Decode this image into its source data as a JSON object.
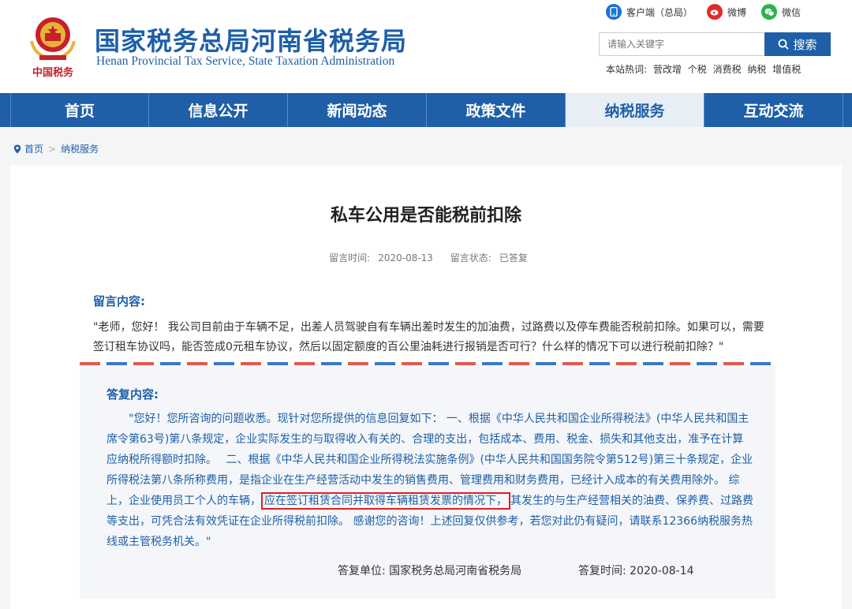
{
  "header": {
    "title_cn": "国家税务总局河南省税务局",
    "title_en": "Henan Provincial Tax Service, State Taxation Administration",
    "seal_text": "中国税务",
    "social": {
      "client": "客户端（总局）",
      "weibo": "微博",
      "wechat": "微信"
    },
    "search": {
      "placeholder": "请输入关键字",
      "button": "搜索"
    },
    "hotwords": {
      "label": "本站热词:",
      "items": [
        "营改增",
        "个税",
        "消费税",
        "纳税",
        "增值税"
      ]
    }
  },
  "nav": {
    "items": [
      {
        "label": "首页"
      },
      {
        "label": "信息公开"
      },
      {
        "label": "新闻动态"
      },
      {
        "label": "政策文件"
      },
      {
        "label": "纳税服务"
      },
      {
        "label": "互动交流"
      }
    ],
    "active_index": 4
  },
  "breadcrumb": {
    "home": "首页",
    "sep": ">",
    "current": "纳税服务"
  },
  "article": {
    "title": "私车公用是否能税前扣除",
    "meta": {
      "time_label": "留言时间:",
      "time": "2020-08-13",
      "status_label": "留言状态:",
      "status": "已答复"
    },
    "question": {
      "heading": "留言内容:",
      "text": "\"老师，您好！ 我公司目前由于车辆不足，出差人员驾驶自有车辆出差时发生的加油费，过路费以及停车费能否税前扣除。如果可以，需要签订租车协议吗，能否签成0元租车协议，然后以固定额度的百公里油耗进行报销是否可行？什么样的情况下可以进行税前扣除？\""
    },
    "answer": {
      "heading": "答复内容:",
      "text_before": "\"您好！您所咨询的问题收悉。现针对您所提供的信息回复如下： 一、根据《中华人民共和国企业所得税法》(中华人民共和国主席令第63号)第八条规定，企业实际发生的与取得收入有关的、合理的支出，包括成本、费用、税金、损失和其他支出，准予在计算应纳税所得额时扣除。　 二、根据《中华人民共和国企业所得税法实施条例》(中华人民共和国国务院令第512号)第三十条规定，企业所得税法第八条所称费用，是指企业在生产经营活动中发生的销售费用、管理费用和财务费用，已经计入成本的有关费用除外。 综上，企业使用员工个人的车辆，",
      "text_highlight": "应在签订租赁合同并取得车辆租赁发票的情况下，",
      "text_after": "其发生的与生产经营相关的油费、保养费、过路费等支出，可凭合法有效凭证在企业所得税前扣除。 感谢您的咨询！上述回复仅供参考，若您对此仍有疑问，请联系12366纳税服务热线或主管税务机关。\"",
      "unit_label": "答复单位:",
      "unit": "国家税务总局河南省税务局",
      "time_label": "答复时间:",
      "time": "2020-08-14"
    }
  },
  "colors": {
    "brand_blue": "#1e5fa8",
    "highlight_red": "#e02020",
    "stripe_red": "#e05a4f",
    "answer_bg": "#f4f6f9"
  }
}
